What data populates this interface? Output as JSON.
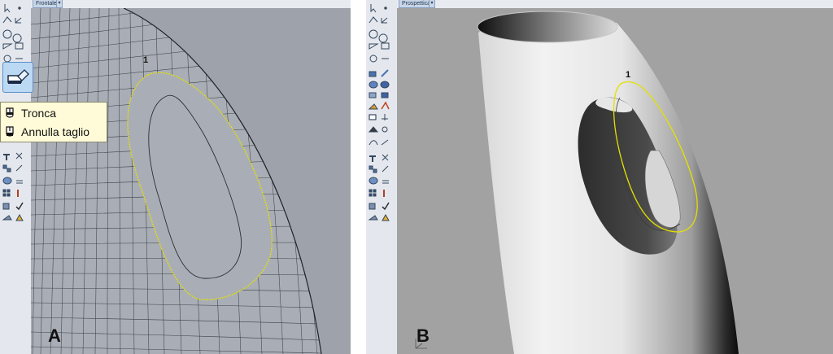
{
  "panel_a": {
    "letter": "A",
    "viewport_title": "Frontale",
    "curve_label": "1",
    "tooltip": {
      "items": [
        {
          "label": "Tronca",
          "icon": "trim-icon"
        },
        {
          "label": "Annulla taglio",
          "icon": "untrim-icon"
        }
      ]
    },
    "active_tool_icon": "trim-tool-icon"
  },
  "panel_b": {
    "letter": "B",
    "viewport_title": "Prospettica",
    "curve_label": "1"
  },
  "colors": {
    "selection_curve": "#e4e000",
    "viewport_bg_a": "#9ea3ab",
    "viewport_bg_b": "#a2a2a2"
  }
}
